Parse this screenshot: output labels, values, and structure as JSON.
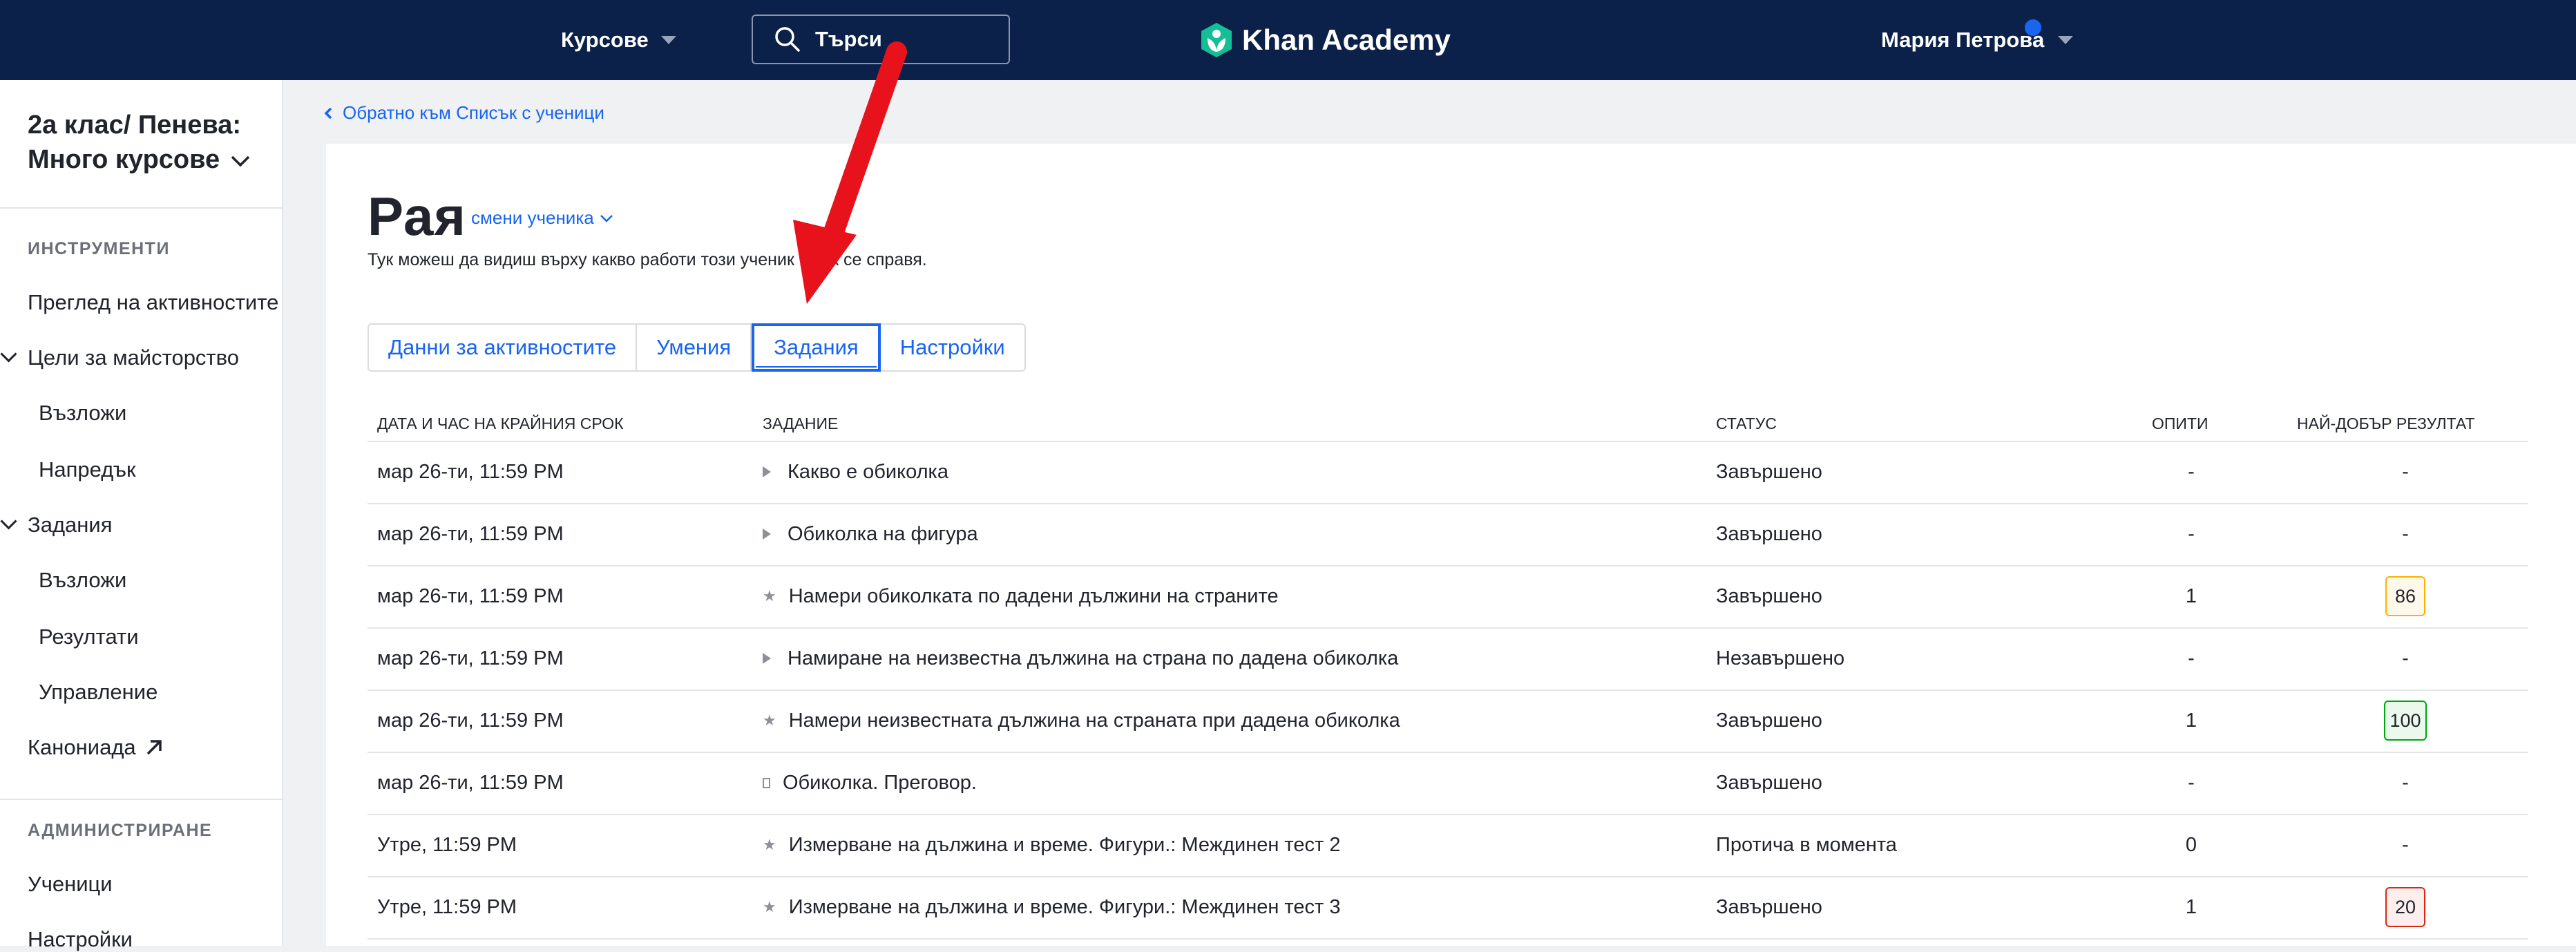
{
  "topbar": {
    "courses_label": "Курсове",
    "search_placeholder": "Търси",
    "logo_text": "Khan Academy",
    "user_name": "Мария Петрова"
  },
  "sidebar": {
    "class_title": "2а клас/ Пенева: Много курсове",
    "tools_heading": "ИНСТРУМЕНТИ",
    "activity_overview": "Преглед на активностите",
    "mastery_goals": "Цели за майсторство",
    "mastery_assign": "Възложи",
    "mastery_progress": "Напредък",
    "assignments": "Задания",
    "assignments_assign": "Възложи",
    "assignments_results": "Резултати",
    "assignments_manage": "Управление",
    "canonical": "Канониада",
    "admin_heading": "АДМИНИСТРИРАНЕ",
    "students": "Ученици",
    "settings": "Настройки"
  },
  "main": {
    "back_link": "Обратно към Списък с ученици",
    "student_name": "Рая",
    "switch_student": "смени ученика",
    "subtitle": "Тук можеш да видиш върху какво работи този ученик и как се справя.",
    "tabs": [
      "Данни за активностите",
      "Умения",
      "Задания",
      "Настройки"
    ],
    "active_tab": "Задания"
  },
  "table": {
    "headers": {
      "due": "ДАТА И ЧАС НА КРАЙНИЯ СРОК",
      "assignment": "ЗАДАНИЕ",
      "status": "СТАТУС",
      "attempts": "ОПИТИ",
      "best": "НАЙ-ДОБЪР РЕЗУЛТАТ"
    },
    "rows": [
      {
        "due": "мар 26-ти, 11:59 PM",
        "icon": "play-icon",
        "title": "Какво е обиколка",
        "status": "Завършено",
        "attempts": "-",
        "best": "-",
        "badge_color": ""
      },
      {
        "due": "мар 26-ти, 11:59 PM",
        "icon": "play-icon",
        "title": "Обиколка на фигура",
        "status": "Завършено",
        "attempts": "-",
        "best": "-",
        "badge_color": ""
      },
      {
        "due": "мар 26-ти, 11:59 PM",
        "icon": "star-icon",
        "title": "Намери обиколката по дадени дължини на страните",
        "status": "Завършено",
        "attempts": "1",
        "best": "86",
        "badge_color": "#ffb100"
      },
      {
        "due": "мар 26-ти, 11:59 PM",
        "icon": "play-icon",
        "title": "Намиране на неизвестна дължина на страна по дадена обиколка",
        "status": "Незавършено",
        "attempts": "-",
        "best": "-",
        "badge_color": ""
      },
      {
        "due": "мар 26-ти, 11:59 PM",
        "icon": "star-icon",
        "title": "Намери неизвестната дължина на страната при дадена обиколка",
        "status": "Завършено",
        "attempts": "1",
        "best": "100",
        "badge_color": "#00a60e"
      },
      {
        "due": "мар 26-ти, 11:59 PM",
        "icon": "document-icon",
        "title": "Обиколка. Преговор.",
        "status": "Завършено",
        "attempts": "-",
        "best": "-",
        "badge_color": ""
      },
      {
        "due": "Утре, 11:59 PM",
        "icon": "star-icon",
        "title": "Измерване на дължина и време. Фигури.: Междинен тест 2",
        "status": "Протича в момента",
        "attempts": "0",
        "best": "-",
        "badge_color": ""
      },
      {
        "due": "Утре, 11:59 PM",
        "icon": "star-icon",
        "title": "Измерване на дължина и време. Фигури.: Междинен тест 3",
        "status": "Завършено",
        "attempts": "1",
        "best": "20",
        "badge_color": "#d92916"
      }
    ]
  },
  "colors": {
    "nav_bg": "#0b2149",
    "link_blue": "#1865f2",
    "annotation_arrow": "#e8121c"
  }
}
